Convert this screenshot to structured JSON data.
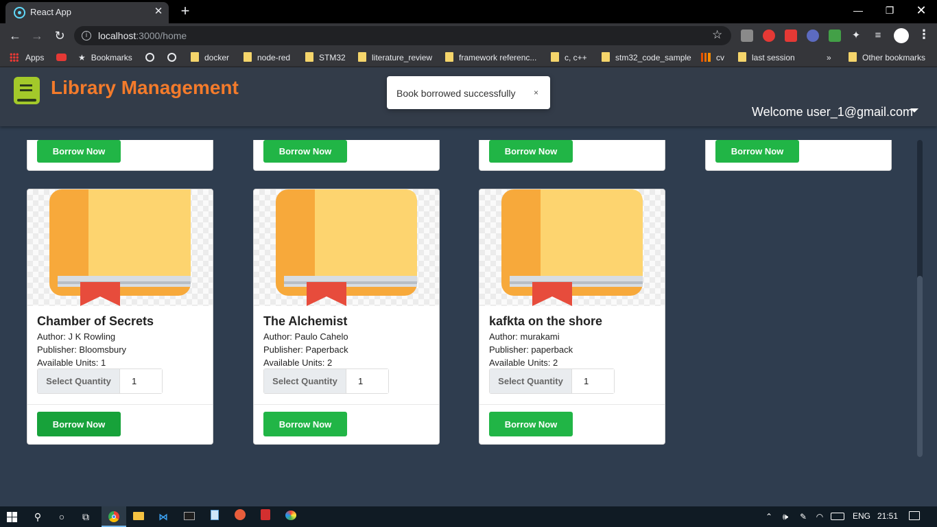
{
  "browser": {
    "tab_title": "React App",
    "url_host": "localhost",
    "url_path": ":3000/home",
    "bookmarks": [
      {
        "label": "Apps"
      },
      {
        "label": "Bookmarks"
      },
      {
        "label": "docker"
      },
      {
        "label": "node-red"
      },
      {
        "label": "STM32"
      },
      {
        "label": "literature_review"
      },
      {
        "label": "framework referenc..."
      },
      {
        "label": "c, c++"
      },
      {
        "label": "stm32_code_sample"
      },
      {
        "label": "cv"
      },
      {
        "label": "last session"
      },
      {
        "label": "Other bookmarks"
      }
    ],
    "overflow_label": "»",
    "extension_colors": [
      "#8a8a8a",
      "#e53935",
      "#e53935",
      "#5c6bc0",
      "#43a047"
    ]
  },
  "app": {
    "title": "Library Management",
    "welcome": "Welcome user_1@gmail.com",
    "brand_color": "#f47b2b"
  },
  "toast": {
    "message": "Book borrowed successfully",
    "close": "×"
  },
  "partial_cards": [
    {
      "button": "Borrow Now"
    },
    {
      "button": "Borrow Now"
    },
    {
      "button": "Borrow Now"
    },
    {
      "button": "Borrow Now"
    }
  ],
  "books": [
    {
      "title": "Chamber of Secrets",
      "author": "Author: J K Rowling",
      "publisher": "Publisher: Bloomsbury",
      "units": "Available Units: 1",
      "qty_label": "Select Quantity",
      "qty_value": "1",
      "button": "Borrow Now"
    },
    {
      "title": "The Alchemist",
      "author": "Author: Paulo Cahelo",
      "publisher": "Publisher: Paperback",
      "units": "Available Units: 2",
      "qty_label": "Select Quantity",
      "qty_value": "1",
      "button": "Borrow Now"
    },
    {
      "title": "kafkta on the shore",
      "author": "Author: murakami",
      "publisher": "Publisher: paperback",
      "units": "Available Units: 2",
      "qty_label": "Select Quantity",
      "qty_value": "1",
      "button": "Borrow Now"
    }
  ],
  "taskbar": {
    "language": "ENG",
    "time": "21:51"
  }
}
